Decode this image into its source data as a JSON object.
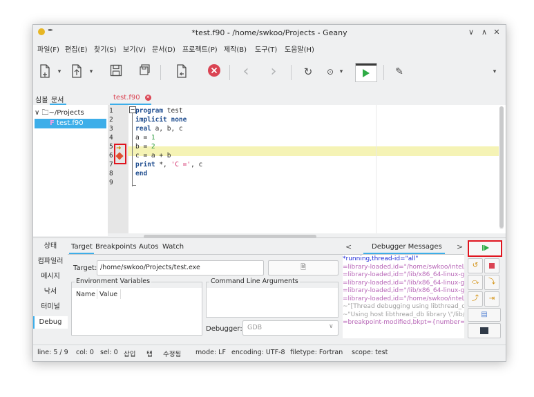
{
  "window": {
    "title": "*test.f90 - /home/swkoo/Projects - Geany",
    "controls": {
      "minimize": "∨",
      "maximize": "∧",
      "close": "✕"
    }
  },
  "menu": [
    "파일(F)",
    "편집(E)",
    "찾기(S)",
    "보기(V)",
    "문서(D)",
    "프로젝트(P)",
    "제작(B)",
    "도구(T)",
    "도움말(H)"
  ],
  "toolbar": {
    "icons": [
      "new-file-icon",
      "open-file-icon",
      "save-icon",
      "save-all-icon",
      "revert-icon",
      "close-file-icon",
      "back-icon",
      "forward-icon",
      "compile-icon",
      "build-icon",
      "run-icon",
      "color-picker-icon"
    ]
  },
  "sidebar": {
    "tabs": [
      "심볼",
      "문서"
    ],
    "tree": {
      "folder": "~/Projects",
      "file": "test.f90"
    }
  },
  "editor": {
    "tab": "test.f90",
    "line_numbers": [
      "1",
      "2",
      "3",
      "4",
      "5",
      "6",
      "7",
      "8",
      "9"
    ],
    "highlighted_line": 5,
    "breakpoint_line": 6
  },
  "bottom_panel": {
    "left_tabs": [
      "상태",
      "컴파일러",
      "메시지",
      "낙서",
      "터미널",
      "Debug"
    ],
    "active_left_tab": "Debug",
    "debug_tabs": [
      "Target",
      "Breakpoints",
      "Autos",
      "Watch"
    ],
    "target_label": "Target:",
    "target_value": "/home/swkoo/Projects/test.exe",
    "env_vars_label": "Environment Variables",
    "env_columns": [
      "Name",
      "Value"
    ],
    "cmd_args_label": "Command Line Arguments",
    "debugger_label": "Debugger:",
    "debugger_value": "GDB",
    "messages_title": "Debugger Messages",
    "messages": [
      {
        "text": "*running,thread-id=\"all\"",
        "color": "#1e2ad8"
      },
      {
        "text": "=library-loaded,id=\"/home/swkoo/intel/c",
        "color": "#b766b7"
      },
      {
        "text": "=library-loaded,id=\"/lib/x86_64-linux-gnu",
        "color": "#b766b7"
      },
      {
        "text": "=library-loaded,id=\"/lib/x86_64-linux-gnu",
        "color": "#b766b7"
      },
      {
        "text": "=library-loaded,id=\"/lib/x86_64-linux-gnu",
        "color": "#b766b7"
      },
      {
        "text": "=library-loaded,id=\"/home/swkoo/intel/c",
        "color": "#b766b7"
      },
      {
        "text": "~\"[Thread debugging using libthread_db",
        "color": "#a0a0a0"
      },
      {
        "text": "~\"Using host libthread_db library \\\"/lib/x8",
        "color": "#a0a0a0"
      },
      {
        "text": "=breakpoint-modified,bkpt={number=\"3",
        "color": "#b766b7"
      }
    ]
  },
  "statusbar": {
    "line": "line: 5 / 9",
    "col": "col: 0",
    "sel": "sel: 0",
    "insert": "삽입",
    "tab": "탭",
    "modified": "수정됨",
    "mode": "mode: LF",
    "encoding": "encoding: UTF-8",
    "filetype": "filetype: Fortran",
    "scope": "scope: test"
  },
  "colors": {
    "accent": "#3daee9",
    "highlight": "#f5f3b5",
    "red": "#da4453",
    "green": "#2eab45"
  }
}
